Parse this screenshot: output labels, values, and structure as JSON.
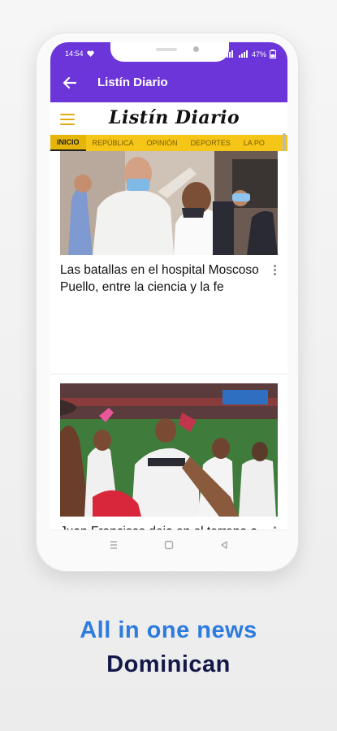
{
  "status": {
    "time": "14:54",
    "battery": "47%"
  },
  "appbar": {
    "title": "Listín Diario"
  },
  "site": {
    "logo": "Listín Diario"
  },
  "tabs": [
    "INICIO",
    "REPÚBLICA",
    "OPINIÓN",
    "DEPORTES",
    "LA PO"
  ],
  "articles": [
    {
      "title": "Las batallas en el hospital Moscoso Puello, entre la ciencia y la fe",
      "image": "hospital-photo"
    },
    {
      "title": "Juan Francisco deja en el terreno a las Águilas, Gigantes triunfan de nuevo",
      "image": "baseball-photo"
    }
  ],
  "colors": {
    "appbar": "#6c35d9",
    "tabs": "#f5c518",
    "tagline_blue": "#2e7be0",
    "tagline_navy": "#141848"
  },
  "tagline": {
    "line1": "All in one news",
    "line2": "Dominican"
  }
}
